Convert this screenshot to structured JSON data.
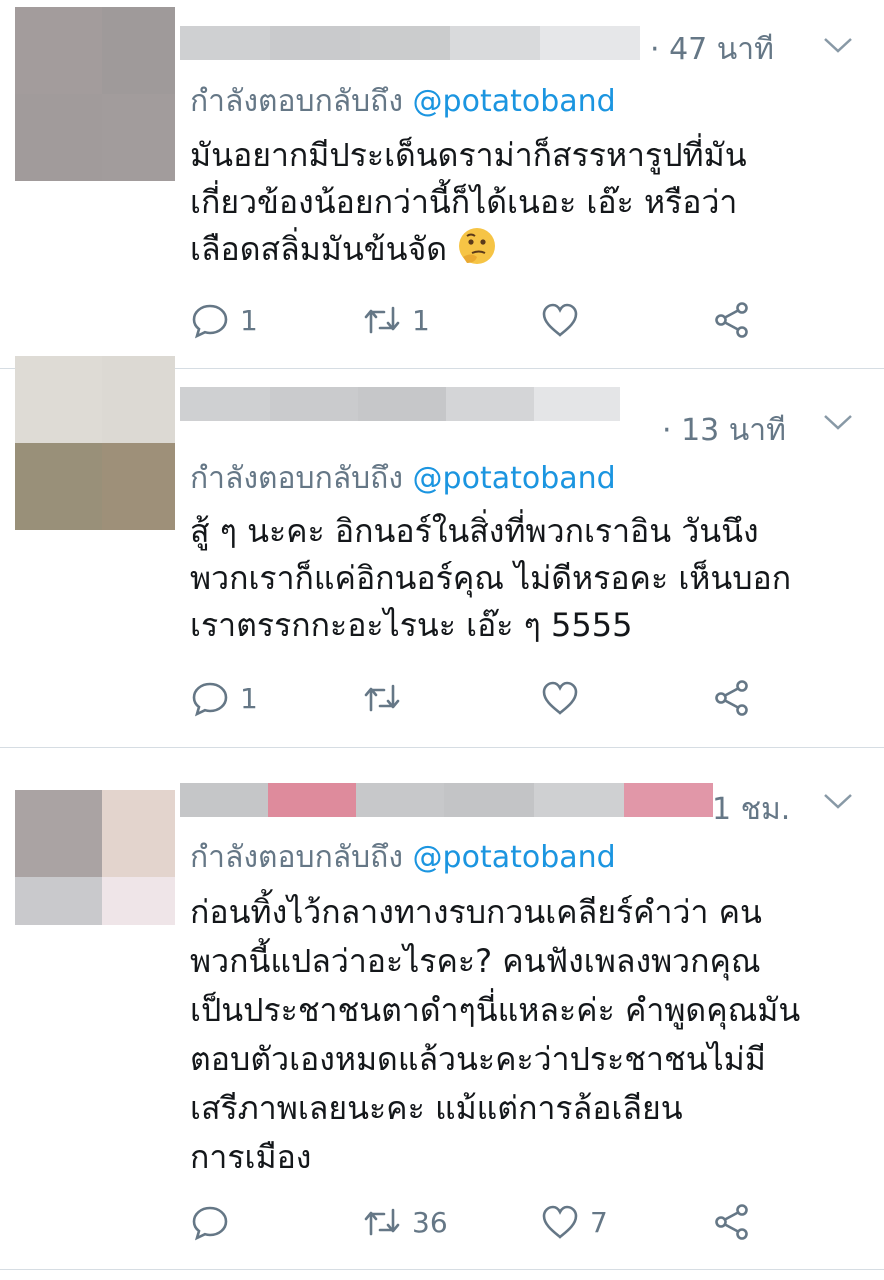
{
  "tweets": [
    {
      "time": "· 47 นาที",
      "reply_prefix": "กำลังตอบกลับถึง",
      "reply_handle": "@potatoband",
      "lines": [
        "มันอยากมีประเด็นดราม่าก็สรรหารูปที่มัน",
        "เกี่ยวข้องน้อยกว่านี้ก็ได้เนอะ เอ๊ะ หรือว่า",
        "เลือดสลิ่มมันข้นจัด"
      ],
      "emoji": "thinking-face",
      "replies": "1",
      "retweets": "1",
      "likes": ""
    },
    {
      "time": "· 13 นาที",
      "reply_prefix": "กำลังตอบกลับถึง",
      "reply_handle": "@potatoband",
      "lines": [
        "สู้ ๆ นะคะ อิกนอร์ในสิ่งที่พวกเราอิน วันนึง",
        "พวกเราก็แค่อิกนอร์คุณ ไม่ดีหรอคะ เห็นบอก",
        "เราตรรกกะอะไรนะ เอ๊ะ ๆ 5555"
      ],
      "replies": "1",
      "retweets": "",
      "likes": ""
    },
    {
      "time": "1 ชม.",
      "reply_prefix": "กำลังตอบกลับถึง",
      "reply_handle": "@potatoband",
      "lines": [
        "ก่อนทิ้งไว้กลางทางรบกวนเคลียร์คำว่า คน",
        "พวกนี้แปลว่าอะไรคะ? คนฟังเพลงพวกคุณ",
        "เป็นประชาชนตาดำๆนี่แหละค่ะ คำพูดคุณมัน",
        "ตอบตัวเองหมดแล้วนะคะว่าประชาชนไม่มี",
        "เสรีภาพเลยนะคะ แม้แต่การล้อเลียน",
        "การเมือง"
      ],
      "replies": "",
      "retweets": "36",
      "likes": "7"
    }
  ],
  "colors": {
    "text": "#14171a",
    "secondary": "#657786",
    "link": "#1b95e0",
    "divider": "#d6dde3"
  }
}
